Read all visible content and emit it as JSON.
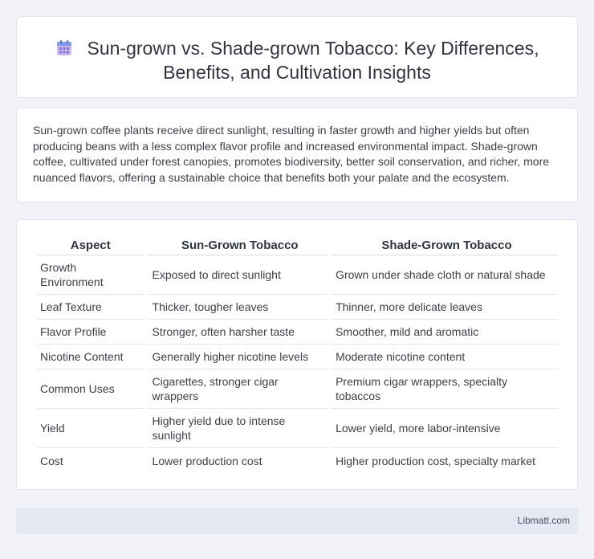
{
  "header": {
    "title_line1": "Sun-grown vs. Shade-grown Tobacco: Key Differences,",
    "title_line2": "Benefits, and Cultivation Insights",
    "icon": "calendar-icon"
  },
  "intro": {
    "text": "Sun-grown coffee plants receive direct sunlight, resulting in faster growth and higher yields but often producing beans with a less complex flavor profile and increased environmental impact. Shade-grown coffee, cultivated under forest canopies, promotes biodiversity, better soil conservation, and richer, more nuanced flavors, offering a sustainable choice that benefits both your palate and the ecosystem."
  },
  "table": {
    "headers": [
      "Aspect",
      "Sun-Grown Tobacco",
      "Shade-Grown Tobacco"
    ],
    "rows": [
      [
        "Growth Environment",
        "Exposed to direct sunlight",
        "Grown under shade cloth or natural shade"
      ],
      [
        "Leaf Texture",
        "Thicker, tougher leaves",
        "Thinner, more delicate leaves"
      ],
      [
        "Flavor Profile",
        "Stronger, often harsher taste",
        "Smoother, mild and aromatic"
      ],
      [
        "Nicotine Content",
        "Generally higher nicotine levels",
        "Moderate nicotine content"
      ],
      [
        "Common Uses",
        "Cigarettes, stronger cigar wrappers",
        "Premium cigar wrappers, specialty tobaccos"
      ],
      [
        "Yield",
        "Higher yield due to intense sunlight",
        "Lower yield, more labor-intensive"
      ],
      [
        "Cost",
        "Lower production cost",
        "Higher production cost, specialty market"
      ]
    ]
  },
  "footer": {
    "site": "Libmatt.com"
  }
}
